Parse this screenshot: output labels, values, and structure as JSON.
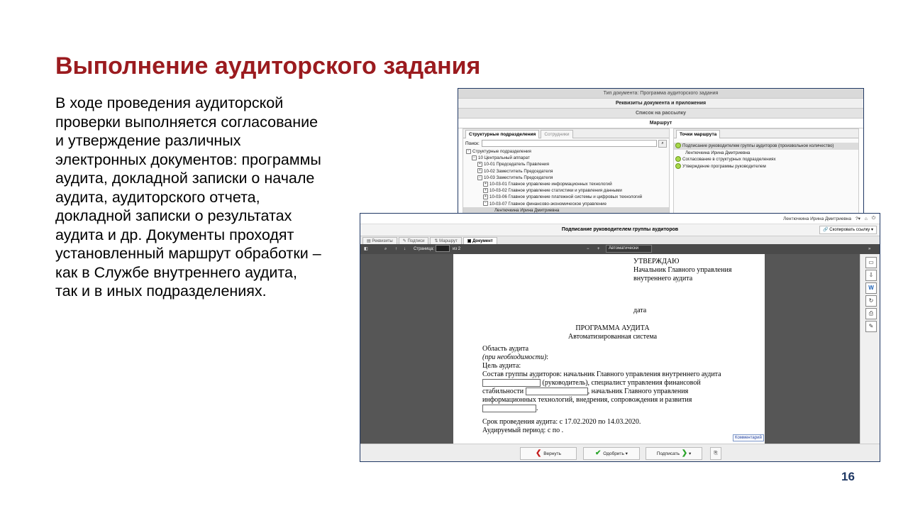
{
  "slide": {
    "title": "Выполнение аудиторского задания",
    "body_lines": [
      "В ходе проведения аудиторской",
      "проверки выполняется согласование",
      "и утверждение различных",
      "электронных документов: программы",
      "аудита, докладной записки о начале",
      "аудита, аудиторского отчета,",
      "докладной записки о результатах",
      "аудита и др. Документы проходят",
      "установленный маршрут обработки –",
      "как в Службе внутреннего аудита,",
      "так и в иных подразделениях."
    ],
    "page_number": "16"
  },
  "back_window": {
    "doc_type": "Тип документа: Программа аудиторского задания",
    "requisites": "Реквизиты документа и приложения",
    "mailing": "Список на рассылку",
    "route": "Маршрут",
    "tab_structure": "Структурные подразделения",
    "tab_employees": "Сотрудники",
    "search_label": "Поиск:",
    "tree": [
      "Структурные подразделения",
      "10 Центральный аппарат",
      "10-01 Председатель Правления",
      "10-02 Заместитель Председателя",
      "10-03 Заместитель Председателя",
      "10-03-01 Главное управление информационных технологий",
      "10-03-02 Главное управление статистики и управления данными",
      "10-03-06 Главное управление платежной системы и цифровых технологий",
      "10-03-07 Главное финансово-экономическое управление",
      "Лентючкина Ирина Дмитриевна"
    ],
    "tab_points": "Точки маршрута",
    "route_points": [
      "Подписание руководителем группы аудиторов (произвольное количество)",
      "Лентючкина Ирина Дмитриевна",
      "Согласование в структурных подразделениях",
      "Утверждение программы руководителем"
    ]
  },
  "front_window": {
    "user_name": "Лентючкина Ирина Дмитриевна",
    "title": "Подписание руководителем группы аудиторов",
    "copy_link": "Скопировать ссылку",
    "tabs": [
      "Реквизиты",
      "Подписи",
      "Маршрут",
      "Документ"
    ],
    "toolbar": {
      "page_label": "Страница:",
      "page_total": "из 2",
      "zoom": "Автоматически"
    },
    "document": {
      "approve": "УТВЕРЖДАЮ",
      "approver_line1": "Начальник Главного управления",
      "approver_line2": "внутреннего аудита",
      "date_label": "дата",
      "heading": "ПРОГРАММА АУДИТА",
      "subheading": "Автоматизированная система",
      "area": "Область аудита",
      "if_needed": "(при необходимости)",
      "if_needed_colon": ":",
      "goal": "Цель аудита:",
      "team_line1": "Состав группы аудиторов: начальник Главного управления внутреннего аудита",
      "team_line2": "(руководитель),       специалист       управления       финансовой",
      "team_line3_a": "стабильности",
      "team_line3_b": ",       начальник       Главного       управления",
      "team_line4": "информационных    технологий,    внедрения,    сопровождения    и    развития",
      "team_line5_end": ".",
      "term": "Срок проведения аудита: с 17.02.2020 по 14.03.2020.",
      "period": "Аудируемый период: с  по .",
      "comment": "Комментарий"
    },
    "buttons": {
      "return": "Вернуть",
      "approve": "Одобрить",
      "sign": "Подписать"
    }
  },
  "colors": {
    "title": "#9b1b1f",
    "page_number": "#1f3864",
    "window_border": "#203864"
  }
}
